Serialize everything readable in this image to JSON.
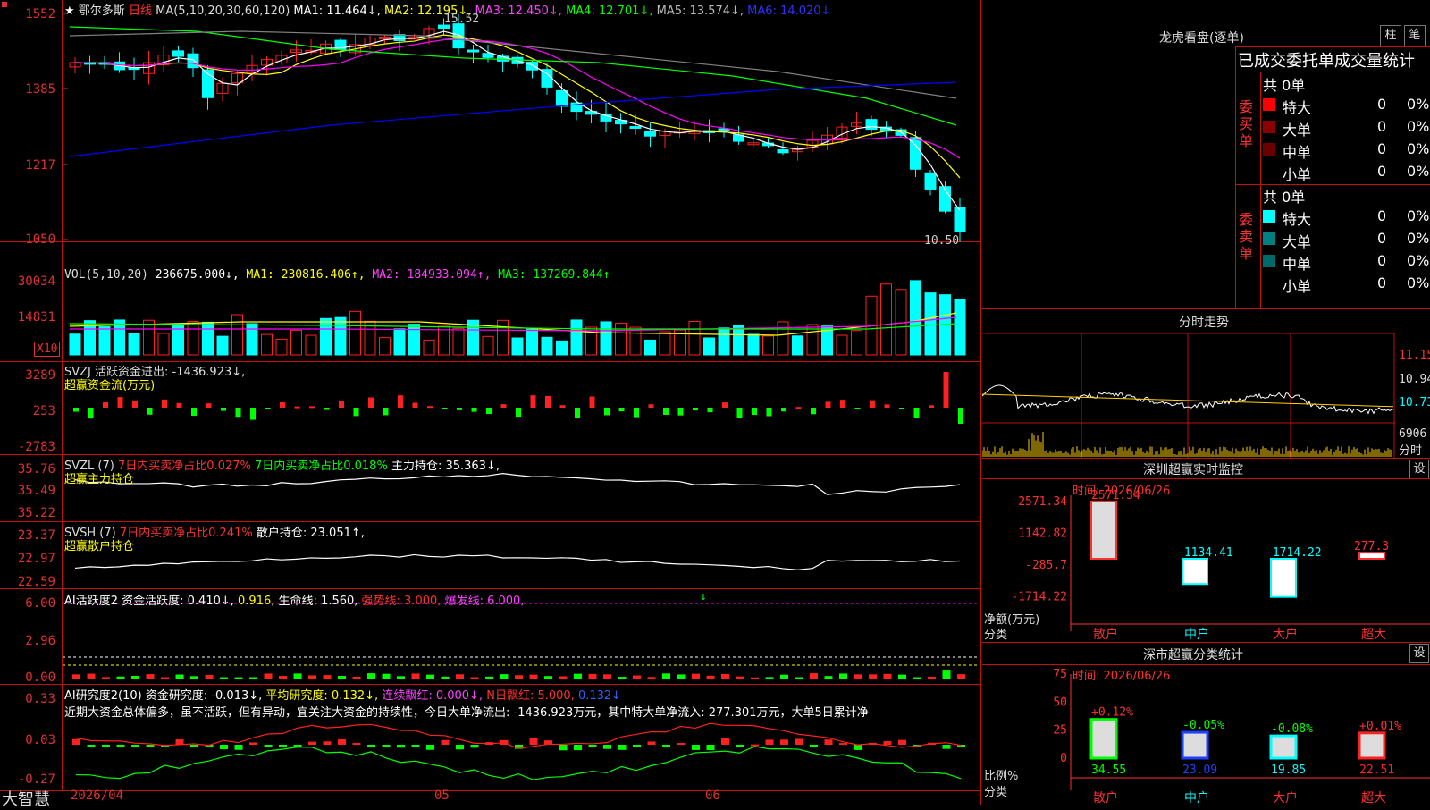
{
  "stock": {
    "name": "鄂尔多斯",
    "period": "日线",
    "star": "★",
    "mark": "☆"
  },
  "main_chart": {
    "ma_header": "MA(5,10,20,30,60,120)",
    "ma1": "MA1: 11.464↓,",
    "ma2": "MA2: 12.195↓,",
    "ma3": "MA3: 12.450↓,",
    "ma4": "MA4: 12.701↓,",
    "ma5": "MA5: 13.574↓,",
    "ma6": "MA6: 14.020↓",
    "high_label": "15.52",
    "low_label": "10.50",
    "y_labels": [
      "1552",
      "1385",
      "1217",
      "1050"
    ]
  },
  "vol_chart": {
    "header": "VOL(5,10,20)",
    "value": "236675.000↓,",
    "ma1": "MA1: 230816.406↑,",
    "ma2": "MA2: 184933.094↑,",
    "ma3": "MA3: 137269.844↑",
    "y_labels": [
      "30034",
      "14831"
    ],
    "unit": "X10"
  },
  "svzj": {
    "header": "SVZJ  活跃资金进出: -1436.923↓,",
    "sub": "超赢资金流(万元)",
    "y_labels": [
      "3289",
      "253",
      "-2783"
    ]
  },
  "svzl": {
    "header": "SVZL (7)",
    "r1": "7日内买卖净占比0.027%",
    "r2": "7日内买卖净占比0.018%",
    "r3": "主力持仓: 35.363↓,",
    "sub": "超赢主力持仓",
    "y_labels": [
      "35.76",
      "35.49",
      "35.22"
    ]
  },
  "svsh": {
    "header": "SVSH (7)",
    "r1": "7日内买卖净占比0.241%",
    "r2": "散户持仓: 23.051↑,",
    "sub": "超赢散户持仓",
    "y_labels": [
      "23.37",
      "22.97",
      "22.59"
    ]
  },
  "ai_active": {
    "h1": "AI活跃度2 资金活跃度: 0.410↓,",
    "h2": "0.916,",
    "h3": "生命线: 1.560,",
    "h4": "强势线: 3.000,",
    "h5": "爆发线: 6.000,",
    "arrow": "↓",
    "y_labels": [
      "6.00",
      "2.96",
      "0.00"
    ]
  },
  "ai_research": {
    "h1": "AI研究度2(10) 资金研究度: -0.013↓,",
    "h2": "平均研究度: 0.132↓,",
    "h3": "连续飘红: 0.000↓,",
    "h4": "N日飘红: 5.000,",
    "h5": "0.132↓",
    "comment": "近期大资金总体偏多，虽不活跃，但有异动，宜关注大资金的持续性，今日大单净流出: -1436.923万元，其中特大单净流入: 277.301万元，大单5日累计净",
    "y_labels": [
      "0.33",
      "0.03",
      "-0.27"
    ]
  },
  "bottom": {
    "brand": "大智慧",
    "dates": [
      "2026/04",
      "05",
      "06"
    ]
  },
  "colors": {
    "up": "#ff2020",
    "down": "#00ffff",
    "grid": "#c01010",
    "ma1": "#ffffff",
    "ma2": "#ffff00",
    "ma3": "#ff00ff",
    "ma4": "#00ff00",
    "ma5": "#808080",
    "ma6": "#0000ff"
  },
  "right": {
    "title": "龙虎看盘(逐单)",
    "btn_bar": "柱",
    "btn_line": "笔",
    "panel_title": "已成交委托单成交量统计",
    "buy": {
      "side": "委买单",
      "total": "共 0单",
      "rows": [
        {
          "label": "特大",
          "count": "0",
          "pct": "0%",
          "color": "#ff0000"
        },
        {
          "label": "大单",
          "count": "0",
          "pct": "0%",
          "color": "#8b0000"
        },
        {
          "label": "中单",
          "count": "0",
          "pct": "0%",
          "color": "#6a0000"
        },
        {
          "label": "小单",
          "count": "0",
          "pct": "0%",
          "color": "#000000"
        }
      ]
    },
    "sell": {
      "side": "委卖单",
      "total": "共 0单",
      "rows": [
        {
          "label": "特大",
          "count": "0",
          "pct": "0%",
          "color": "#00ffff"
        },
        {
          "label": "大单",
          "count": "0",
          "pct": "0%",
          "color": "#008080"
        },
        {
          "label": "中单",
          "count": "0",
          "pct": "0%",
          "color": "#006a6a"
        },
        {
          "label": "小单",
          "count": "0",
          "pct": "0%",
          "color": "#000000"
        }
      ]
    },
    "intraday": {
      "title": "分时走势",
      "y_labels": [
        "11.15",
        "10.94",
        "10.73",
        "6906"
      ],
      "unit": "分时"
    },
    "monitor": {
      "title": "深圳超赢实时监控",
      "settings": "设",
      "time": "时间: 2026/06/26",
      "axis_title": "净额(万元)",
      "axis_sub": "分类",
      "y_labels": [
        "2571.34",
        "1142.82",
        "-285.7",
        "-1714.22"
      ],
      "bars": [
        {
          "name": "散户",
          "value": 2571.34,
          "label": "2571.34"
        },
        {
          "name": "中户",
          "value": -1134.41,
          "label": "-1134.41"
        },
        {
          "name": "大户",
          "value": -1714.22,
          "label": "-1714.22"
        },
        {
          "name": "超大",
          "value": 277.3,
          "label": "277.3"
        }
      ]
    },
    "classify": {
      "title": "深市超赢分类统计",
      "settings": "设",
      "time": "时间: 2026/06/26",
      "axis_title": "比例%",
      "axis_sub": "分类",
      "y_labels": [
        "75",
        "50",
        "25",
        "0"
      ],
      "bars": [
        {
          "name": "散户",
          "pct": 34.55,
          "label": "34.55",
          "change": "+0.12%"
        },
        {
          "name": "中户",
          "pct": 23.09,
          "label": "23.09",
          "change": "-0.05%"
        },
        {
          "name": "大户",
          "pct": 19.85,
          "label": "19.85",
          "change": "-0.08%"
        },
        {
          "name": "超大",
          "pct": 22.51,
          "label": "22.51",
          "change": "+0.01%"
        }
      ]
    }
  }
}
